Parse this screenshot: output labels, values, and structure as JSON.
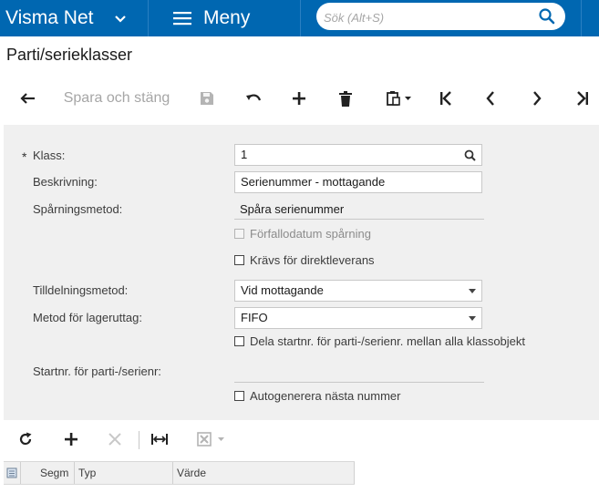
{
  "topbar": {
    "brand": "Visma Net",
    "menu_label": "Meny",
    "search_placeholder": "Sök (Alt+S)",
    "colors": {
      "background": "#0067b1",
      "text": "#ffffff"
    }
  },
  "page": {
    "title": "Parti/serieklasser"
  },
  "toolbar": {
    "save_close_label": "Spara och stäng",
    "icons": [
      "back-arrow-icon",
      "save-icon",
      "undo-icon",
      "add-icon",
      "delete-icon",
      "copy-paste-icon",
      "first-record-icon",
      "previous-record-icon",
      "next-record-icon",
      "last-record-icon"
    ]
  },
  "form": {
    "required_marker": "*",
    "class_label": "Klass:",
    "class_value": "1",
    "description_label": "Beskrivning:",
    "description_value": "Serienummer - mottagande",
    "tracking_label": "Spårningsmetod:",
    "tracking_value": "Spåra serienummer",
    "expiry_tracking_label": "Förfallodatum spårning",
    "expiry_tracking_checked": false,
    "drop_ship_label": "Krävs för direktleverans",
    "drop_ship_checked": false,
    "assignment_label": "Tilldelningsmetod:",
    "assignment_value": "Vid mottagande",
    "issue_method_label": "Metod för lageruttag:",
    "issue_method_value": "FIFO",
    "share_numbering_label": "Dela startnr. för parti-/serienr. mellan alla klassobjekt",
    "share_numbering_checked": false,
    "start_number_label": "Startnr. för parti-/serienr:",
    "start_number_value": "",
    "autogenerate_label": "Autogenerera nästa nummer",
    "autogenerate_checked": false
  },
  "grid": {
    "toolbar_icons": [
      "refresh-icon",
      "add-row-icon",
      "delete-row-icon",
      "fit-columns-icon",
      "export-excel-icon"
    ],
    "columns": [
      "Segm",
      "Typ",
      "Värde"
    ]
  }
}
